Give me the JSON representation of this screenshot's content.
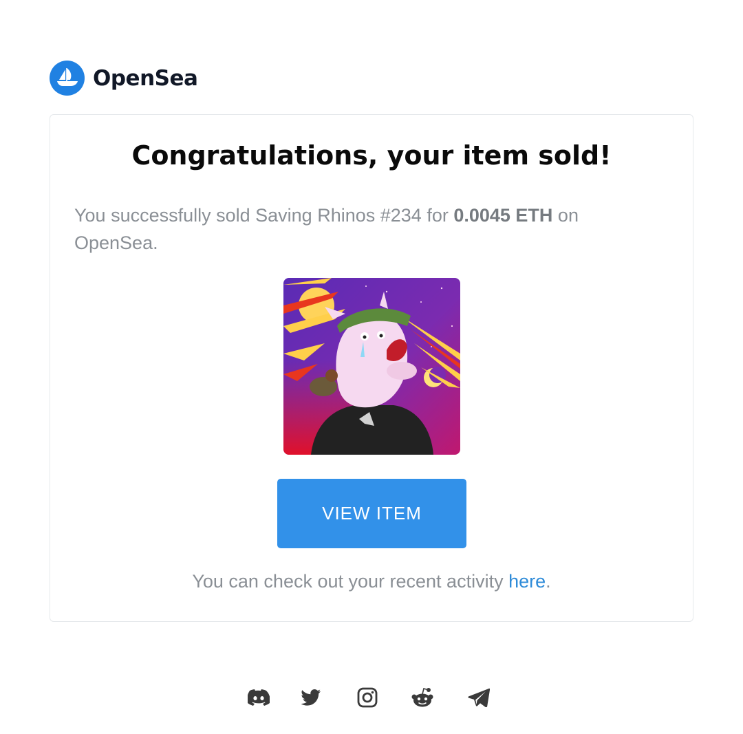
{
  "brand": {
    "name": "OpenSea",
    "color": "#2081e2"
  },
  "card": {
    "title": "Congratulations, your item sold!",
    "message": {
      "prefix": "You successfully sold Saving Rhinos #234 for ",
      "price": "0.0045 ETH",
      "suffix": " on OpenSea."
    },
    "nft_image": {
      "icon": "rhino-nft-artwork"
    },
    "button_label": "VIEW ITEM",
    "activity": {
      "prefix": "You can check out your recent activity ",
      "link": "here",
      "suffix": "."
    }
  },
  "footer": {
    "socials": [
      {
        "name": "discord-icon"
      },
      {
        "name": "twitter-icon"
      },
      {
        "name": "instagram-icon"
      },
      {
        "name": "reddit-icon"
      },
      {
        "name": "telegram-icon"
      }
    ]
  },
  "colors": {
    "button": "#3291e9",
    "link": "#2e8bd8",
    "muted_text": "#8a8f95"
  }
}
